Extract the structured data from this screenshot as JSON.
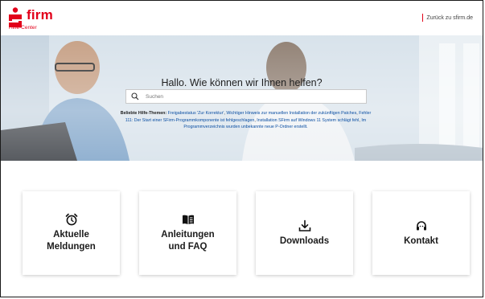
{
  "header": {
    "brand": "firm",
    "subtitle": "Hilfe-Center",
    "back_link": "Zurück zu sfirm.de"
  },
  "hero": {
    "title": "Hallo. Wie können wir Ihnen helfen?",
    "search_placeholder": "Suchen",
    "popular_label": "Beliebte Hilfe-Themen:",
    "popular_topics": [
      "Freigabestatus 'Zur Korrektur'",
      "Wichtiger Hinweis zur manuellen Installation der zukünftigen Patches",
      "Fehler 111: Der Start einer SFirm-Programmkomponente ist fehlgeschlagen",
      "Installation SFirm auf Windows 11 System schlägt fehl",
      "Im Programmverzeichnis wurden unbekannte neue P-Ordner erstellt."
    ]
  },
  "cards": [
    {
      "label": "Aktuelle\nMeldungen",
      "icon": "alarm-clock-icon"
    },
    {
      "label": "Anleitungen\nund FAQ",
      "icon": "open-book-icon"
    },
    {
      "label": "Downloads",
      "icon": "download-icon"
    },
    {
      "label": "Kontakt",
      "icon": "headset-icon"
    }
  ],
  "colors": {
    "brand": "#e2001a",
    "link": "#0b4fa3"
  }
}
